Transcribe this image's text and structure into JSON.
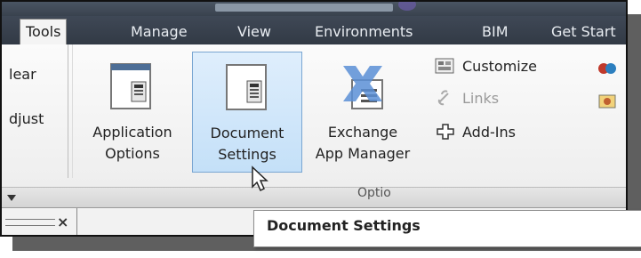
{
  "ribbon": {
    "tabs": [
      {
        "label": "Tools",
        "active": true
      },
      {
        "label": "Manage"
      },
      {
        "label": "View"
      },
      {
        "label": "Environments"
      },
      {
        "label": "BIM"
      },
      {
        "label": "Get Start"
      }
    ],
    "left_partial": {
      "line1": "lear",
      "line2": "djust"
    },
    "buttons": {
      "application_options": {
        "line1": "Application",
        "line2": "Options",
        "icon": "application-options-icon"
      },
      "document_settings": {
        "line1": "Document",
        "line2": "Settings",
        "icon": "document-settings-icon"
      },
      "exchange_app_manager": {
        "line1": "Exchange",
        "line2": "App Manager",
        "icon": "exchange-icon"
      }
    },
    "small": {
      "customize": {
        "label": "Customize",
        "icon": "customize-icon"
      },
      "links": {
        "label": "Links",
        "icon": "links-icon"
      },
      "addins": {
        "label": "Add-Ins",
        "icon": "add-ins-icon"
      }
    },
    "panel_title_partial": "Optio",
    "colors": {
      "accent_hover": "#c4e0f8",
      "tab_bar": "#3a434f"
    }
  },
  "tooltip": {
    "title": "Document Settings"
  },
  "bottom": {
    "close_glyph": "×"
  }
}
